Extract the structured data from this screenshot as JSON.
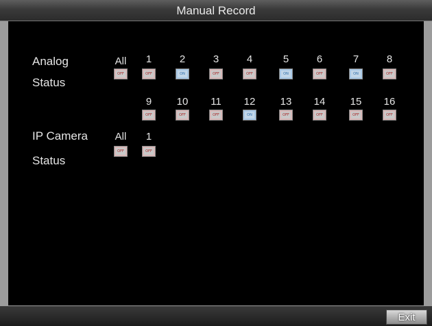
{
  "window": {
    "title": "Manual Record"
  },
  "analog": {
    "label": "Analog",
    "status_label": "Status",
    "all": {
      "label": "All",
      "state": "OFF"
    },
    "channels": [
      {
        "num": "1",
        "state": "OFF"
      },
      {
        "num": "2",
        "state": "ON"
      },
      {
        "num": "3",
        "state": "OFF"
      },
      {
        "num": "4",
        "state": "OFF"
      },
      {
        "num": "5",
        "state": "ON"
      },
      {
        "num": "6",
        "state": "OFF"
      },
      {
        "num": "7",
        "state": "ON"
      },
      {
        "num": "8",
        "state": "OFF"
      },
      {
        "num": "9",
        "state": "OFF"
      },
      {
        "num": "10",
        "state": "OFF"
      },
      {
        "num": "11",
        "state": "OFF"
      },
      {
        "num": "12",
        "state": "ON"
      },
      {
        "num": "13",
        "state": "OFF"
      },
      {
        "num": "14",
        "state": "OFF"
      },
      {
        "num": "15",
        "state": "OFF"
      },
      {
        "num": "16",
        "state": "OFF"
      }
    ]
  },
  "ip_camera": {
    "label": "IP Camera",
    "status_label": "Status",
    "all": {
      "label": "All",
      "state": "OFF"
    },
    "channels": [
      {
        "num": "1",
        "state": "OFF"
      }
    ]
  },
  "footer": {
    "exit_label": "Exit"
  },
  "colors": {
    "off_text": "#a82020",
    "on_text": "#2a6ba8",
    "panel_bg": "#000000"
  }
}
